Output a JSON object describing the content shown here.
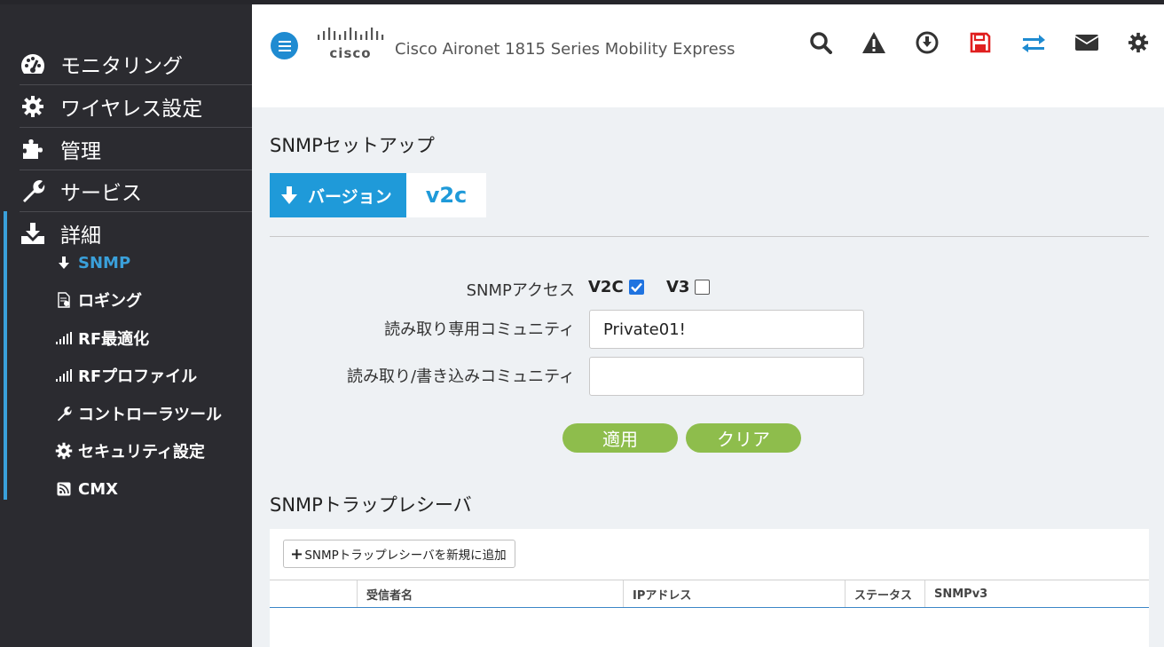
{
  "app": {
    "brand": "cisco",
    "title": "Cisco Aironet 1815 Series Mobility Express"
  },
  "colors": {
    "accent": "#1f9ad9",
    "sidebar_bg": "#2b2b30",
    "button_green": "#8ebd4c",
    "save_red": "#e02020",
    "swap_blue": "#1f8bd1"
  },
  "header_icons": [
    "search-icon",
    "warning-icon",
    "download-icon",
    "save-icon",
    "swap-icon",
    "mail-icon",
    "gear-icon"
  ],
  "sidebar": {
    "main": [
      {
        "label": "モニタリング",
        "icon": "dashboard-icon"
      },
      {
        "label": "ワイヤレス設定",
        "icon": "gear-icon"
      },
      {
        "label": "管理",
        "icon": "puzzle-icon"
      },
      {
        "label": "サービス",
        "icon": "wrench-icon"
      },
      {
        "label": "詳細",
        "icon": "download-tray-icon"
      }
    ],
    "sub": [
      {
        "label": "SNMP",
        "icon": "arrow-down-icon",
        "active": true
      },
      {
        "label": "ロギング",
        "icon": "log-file-icon"
      },
      {
        "label": "RF最適化",
        "icon": "signal-bars-icon"
      },
      {
        "label": "RFプロファイル",
        "icon": "signal-bars-icon"
      },
      {
        "label": "コントローラツール",
        "icon": "wrench-icon"
      },
      {
        "label": "セキュリティ設定",
        "icon": "gear-icon"
      },
      {
        "label": "CMX",
        "icon": "rss-icon"
      }
    ]
  },
  "setup": {
    "title": "SNMPセットアップ",
    "version_label": "バージョン",
    "version_value": "v2c"
  },
  "form": {
    "access_label": "SNMPアクセス",
    "v2c_label": "V2C",
    "v2c_checked": true,
    "v3_label": "V3",
    "v3_checked": false,
    "ro_label": "読み取り専用コミュニティ",
    "ro_value": "Private01!",
    "rw_label": "読み取り/書き込みコミュニティ",
    "rw_value": "",
    "apply_label": "適用",
    "clear_label": "クリア"
  },
  "trap": {
    "title": "SNMPトラップレシーバ",
    "add_label": "SNMPトラップレシーバを新規に追加",
    "columns": [
      "",
      "受信者名",
      "IPアドレス",
      "ステータス",
      "SNMPv3"
    ]
  }
}
